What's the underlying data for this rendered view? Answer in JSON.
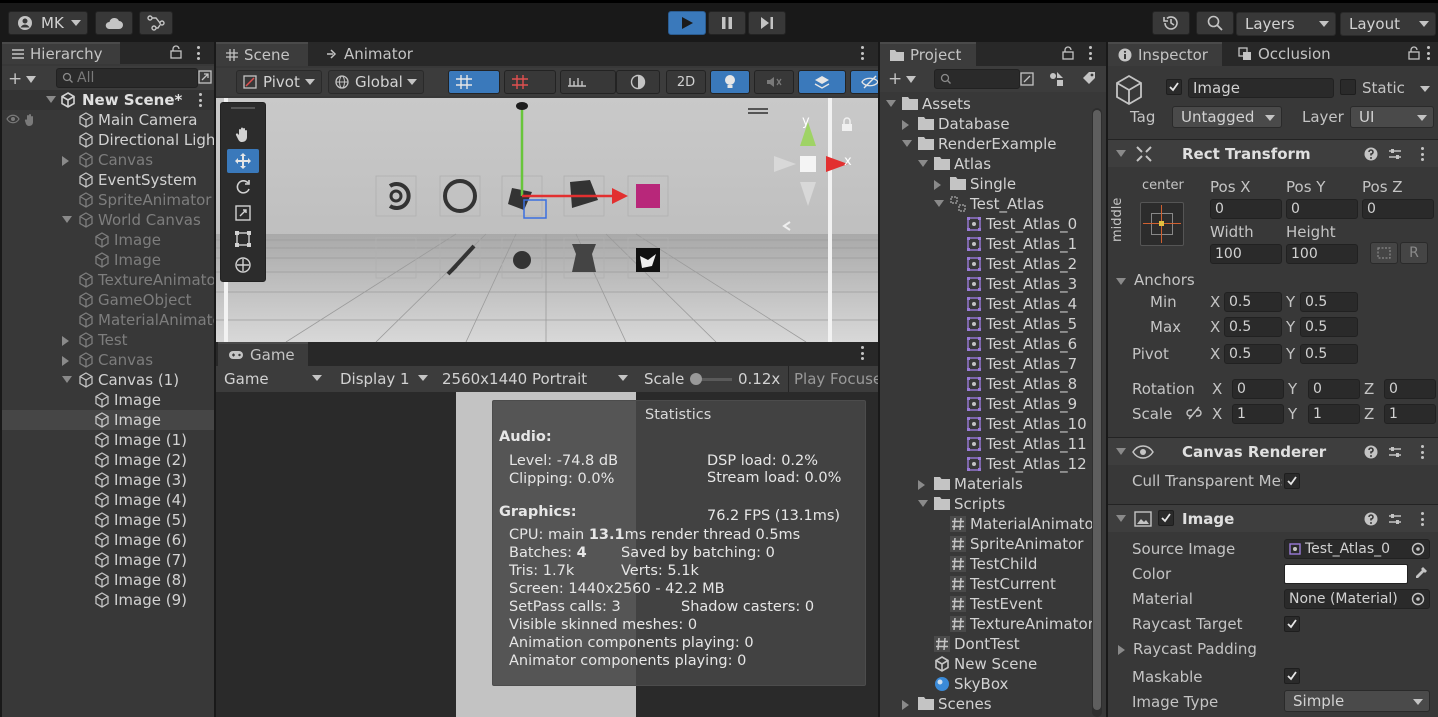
{
  "toolbar": {
    "account": "MK",
    "layers": "Layers",
    "layout": "Layout"
  },
  "hierarchy": {
    "tab": "Hierarchy",
    "search_placeholder": "All",
    "scene_name": "New Scene*",
    "items": [
      {
        "label": "Main Camera",
        "state": "normal"
      },
      {
        "label": "Directional Ligh",
        "state": "normal"
      },
      {
        "label": "Canvas",
        "state": "dim"
      },
      {
        "label": "EventSystem",
        "state": "normal"
      },
      {
        "label": "SpriteAnimator",
        "state": "dim"
      },
      {
        "label": "World Canvas",
        "state": "dim"
      },
      {
        "label": "Image",
        "state": "dim"
      },
      {
        "label": "Image",
        "state": "dim"
      },
      {
        "label": "TextureAnimato",
        "state": "dim"
      },
      {
        "label": "GameObject",
        "state": "dim"
      },
      {
        "label": "MaterialAnimato",
        "state": "dim"
      },
      {
        "label": "Test",
        "state": "dim"
      },
      {
        "label": "Canvas",
        "state": "dim"
      },
      {
        "label": "Canvas (1)",
        "state": "normal"
      },
      {
        "label": "Image",
        "state": "normal"
      },
      {
        "label": "Image",
        "state": "selected"
      },
      {
        "label": "Image (1)",
        "state": "normal"
      },
      {
        "label": "Image (2)",
        "state": "normal"
      },
      {
        "label": "Image (3)",
        "state": "normal"
      },
      {
        "label": "Image (4)",
        "state": "normal"
      },
      {
        "label": "Image (5)",
        "state": "normal"
      },
      {
        "label": "Image (6)",
        "state": "normal"
      },
      {
        "label": "Image (7)",
        "state": "normal"
      },
      {
        "label": "Image (8)",
        "state": "normal"
      },
      {
        "label": "Image (9)",
        "state": "normal"
      }
    ]
  },
  "scene": {
    "tab_scene": "Scene",
    "tab_animator": "Animator",
    "pivot": "Pivot",
    "global": "Global",
    "mode_2d": "2D",
    "gizmo_y": "y",
    "gizmo_x": "x"
  },
  "game": {
    "tab": "Game",
    "view": "Game",
    "display": "Display 1",
    "resolution": "2560x1440 Portrait",
    "scale_label": "Scale",
    "scale_value": "0.12x",
    "scale_level": 0.05,
    "play_focused": "Play Focused",
    "stats": {
      "title": "Statistics",
      "audio": "Audio:",
      "level": "Level: -74.8 dB",
      "clipping": "Clipping: 0.0%",
      "dsp": "DSP load: 0.2%",
      "stream": "Stream load: 0.0%",
      "graphics": "Graphics:",
      "fps": "76.2 FPS (13.1ms)",
      "cpu_pre": "CPU: main ",
      "cpu_ms": "13.1",
      "cpu_post": "ms  render thread 0.5ms",
      "batches_pre": "Batches: ",
      "batches_val": "4",
      "saved": "Saved by batching: 0",
      "tris": "Tris: 1.7k",
      "verts": "Verts: 5.1k",
      "screen": "Screen: 1440x2560 - 42.2 MB",
      "setpass": "SetPass calls: 3",
      "shadow": "Shadow casters: 0",
      "skinned": "Visible skinned meshes: 0",
      "anim": "Animation components playing: 0",
      "animator": "Animator components playing: 0"
    }
  },
  "project": {
    "tab": "Project",
    "items": [
      {
        "label": "Assets",
        "icon": "folder",
        "fold": "down"
      },
      {
        "label": "Database",
        "icon": "folder",
        "fold": "right"
      },
      {
        "label": "RenderExample",
        "icon": "folder",
        "fold": "down"
      },
      {
        "label": "Atlas",
        "icon": "folder",
        "fold": "down"
      },
      {
        "label": "Single",
        "icon": "folder",
        "fold": "right"
      },
      {
        "label": "Test_Atlas",
        "icon": "atlas",
        "fold": "down"
      },
      {
        "label": "Test_Atlas_0",
        "icon": "sprite",
        "fold": ""
      },
      {
        "label": "Test_Atlas_1",
        "icon": "sprite",
        "fold": ""
      },
      {
        "label": "Test_Atlas_2",
        "icon": "sprite",
        "fold": ""
      },
      {
        "label": "Test_Atlas_3",
        "icon": "sprite",
        "fold": ""
      },
      {
        "label": "Test_Atlas_4",
        "icon": "sprite",
        "fold": ""
      },
      {
        "label": "Test_Atlas_5",
        "icon": "sprite",
        "fold": ""
      },
      {
        "label": "Test_Atlas_6",
        "icon": "sprite",
        "fold": ""
      },
      {
        "label": "Test_Atlas_7",
        "icon": "sprite",
        "fold": ""
      },
      {
        "label": "Test_Atlas_8",
        "icon": "sprite",
        "fold": ""
      },
      {
        "label": "Test_Atlas_9",
        "icon": "sprite",
        "fold": ""
      },
      {
        "label": "Test_Atlas_10",
        "icon": "sprite",
        "fold": ""
      },
      {
        "label": "Test_Atlas_11",
        "icon": "sprite",
        "fold": ""
      },
      {
        "label": "Test_Atlas_12",
        "icon": "sprite",
        "fold": ""
      },
      {
        "label": "Materials",
        "icon": "folder",
        "fold": "right"
      },
      {
        "label": "Scripts",
        "icon": "folder",
        "fold": "down"
      },
      {
        "label": "MaterialAnimator",
        "icon": "script",
        "fold": ""
      },
      {
        "label": "SpriteAnimator",
        "icon": "script",
        "fold": ""
      },
      {
        "label": "TestChild",
        "icon": "script",
        "fold": ""
      },
      {
        "label": "TestCurrent",
        "icon": "script",
        "fold": ""
      },
      {
        "label": "TestEvent",
        "icon": "script",
        "fold": ""
      },
      {
        "label": "TextureAnimator",
        "icon": "script",
        "fold": ""
      },
      {
        "label": "DontTest",
        "icon": "script",
        "fold": ""
      },
      {
        "label": "New Scene",
        "icon": "scene",
        "fold": ""
      },
      {
        "label": "SkyBox",
        "icon": "material",
        "fold": ""
      },
      {
        "label": "Scenes",
        "icon": "folder",
        "fold": "right"
      }
    ]
  },
  "inspector": {
    "tab_inspector": "Inspector",
    "tab_occlusion": "Occlusion",
    "object_name": "Image",
    "static": "Static",
    "tag_label": "Tag",
    "tag_value": "Untagged",
    "layer_label": "Layer",
    "layer_value": "UI",
    "rect": {
      "title": "Rect Transform",
      "anchor_h": "center",
      "anchor_v": "middle",
      "posx_label": "Pos X",
      "posx": "0",
      "posy_label": "Pos Y",
      "posy": "0",
      "posz_label": "Pos Z",
      "posz": "0",
      "width_label": "Width",
      "width": "100",
      "height_label": "Height",
      "height": "100",
      "r_label": "R",
      "anchors": "Anchors",
      "min": "Min",
      "max": "Max",
      "pivot": "Pivot",
      "x": "X",
      "y": "Y",
      "z": "Z",
      "min_x": "0.5",
      "min_y": "0.5",
      "max_x": "0.5",
      "max_y": "0.5",
      "pivot_x": "0.5",
      "pivot_y": "0.5",
      "rotation": "Rotation",
      "rot_x": "0",
      "rot_y": "0",
      "rot_z": "0",
      "scale": "Scale",
      "scale_x": "1",
      "scale_y": "1",
      "scale_z": "1"
    },
    "canvas_renderer": {
      "title": "Canvas Renderer",
      "cull": "Cull Transparent Mesh"
    },
    "image": {
      "title": "Image",
      "source_label": "Source Image",
      "source": "Test_Atlas_0",
      "color_label": "Color",
      "color": "#ffffff",
      "material_label": "Material",
      "material": "None (Material)",
      "raycast_target": "Raycast Target",
      "raycast_padding": "Raycast Padding",
      "maskable": "Maskable",
      "type_label": "Image Type",
      "type": "Simple"
    }
  },
  "colors": {
    "accent": "#3a79bb",
    "panel": "#383838",
    "selected_row": "#2c5d87"
  }
}
